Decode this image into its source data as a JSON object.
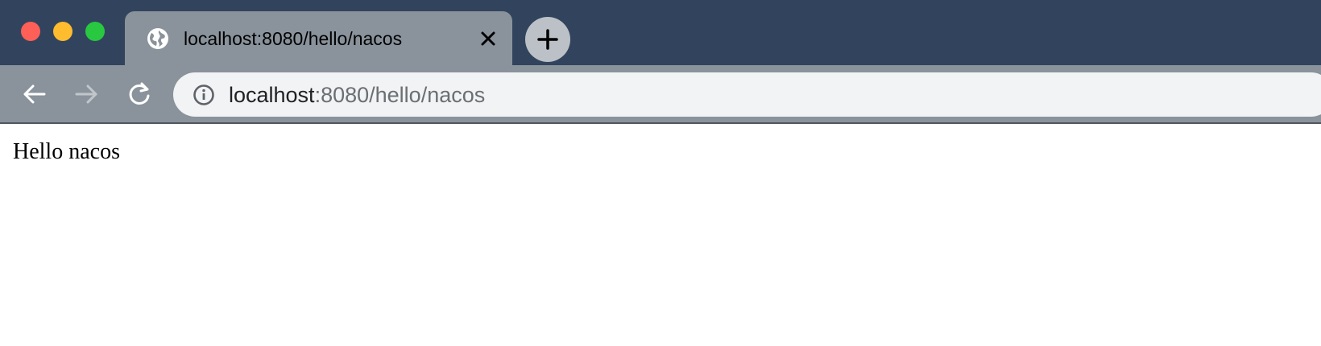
{
  "window": {
    "controls": [
      "close",
      "minimize",
      "maximize"
    ]
  },
  "tab": {
    "title": "localhost:8080/hello/nacos",
    "favicon": "globe-icon"
  },
  "toolbar": {
    "url_host": "localhost",
    "url_rest": ":8080/hello/nacos"
  },
  "page": {
    "body_text": "Hello nacos"
  },
  "colors": {
    "titlebar": "#32445d",
    "tab": "#8a939c",
    "omnibox": "#f1f3f4"
  }
}
